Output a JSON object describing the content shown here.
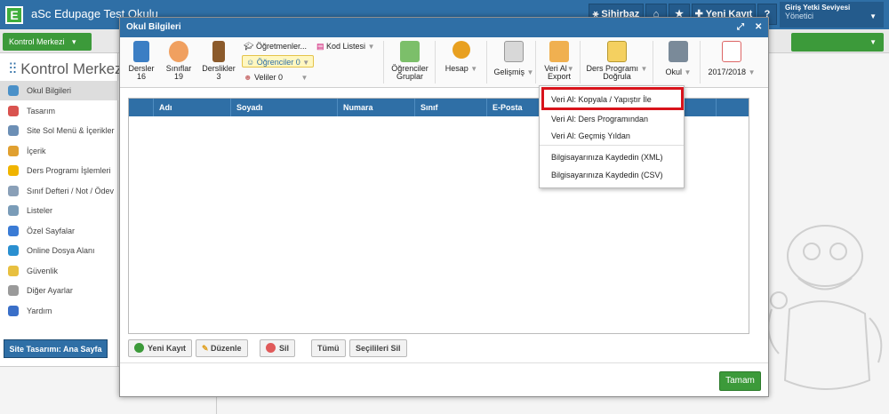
{
  "app": {
    "logo_letter": "E",
    "title": "aSc Edupage Test Okulu"
  },
  "topbar": {
    "sihirbaz": "Sihirbaz",
    "yeni_kayit": "Yeni Kayıt",
    "help": "?",
    "user_line1": "Giriş Yetki Seviyesi",
    "user_line2": "Yönetici"
  },
  "kontrol_button": "Kontrol Merkezi",
  "sidebar": {
    "title": "Kontrol Merkezi",
    "items": [
      {
        "label": "Okul Bilgileri",
        "color": "#4a90c8"
      },
      {
        "label": "Tasarım",
        "color": "#d9534f"
      },
      {
        "label": "Site Sol Menü & İçerikler",
        "color": "#6c8fb5"
      },
      {
        "label": "İçerik",
        "color": "#e0a030"
      },
      {
        "label": "Ders Programı İşlemleri",
        "color": "#f0b400"
      },
      {
        "label": "Sınıf Defteri / Not / Ödev",
        "color": "#8aa0b8"
      },
      {
        "label": "Listeler",
        "color": "#7a9cb8"
      },
      {
        "label": "Özel Sayfalar",
        "color": "#3a7bd5"
      },
      {
        "label": "Online Dosya Alanı",
        "color": "#2a8fd0"
      },
      {
        "label": "Güvenlik",
        "color": "#e8c040"
      },
      {
        "label": "Diğer Ayarlar",
        "color": "#9a9a9a"
      },
      {
        "label": "Yardım",
        "color": "#3a6fc8"
      }
    ],
    "site_button": "Site Tasarımı: Ana Sayfa"
  },
  "modal": {
    "title": "Okul Bilgileri",
    "toolbar": {
      "dersler": {
        "label": "Dersler",
        "count": "16"
      },
      "siniflar": {
        "label": "Sınıflar",
        "count": "19"
      },
      "derslikler": {
        "label": "Derslikler",
        "count": "3"
      },
      "ogretmenler": "Öğretmenler...",
      "ogrenciler": "Öğrenciler 0",
      "veliler": "Veliler 0",
      "kod_listesi": "Kod Listesi",
      "ogrenci_gruplar": {
        "line1": "Öğrenciler",
        "line2": "Gruplar"
      },
      "hesap": "Hesap",
      "gelismis": "Gelişmiş",
      "veri_al": {
        "line1": "Veri Al",
        "line2": "Export"
      },
      "ders_programi": {
        "line1": "Ders Programı",
        "line2": "Doğrula"
      },
      "okul": "Okul",
      "year": "2017/2018"
    },
    "grid_columns": [
      "Adı",
      "Soyadı",
      "Numara",
      "Sınıf",
      "E-Posta"
    ],
    "buttons": {
      "yeni_kayit": "Yeni Kayıt",
      "duzenle": "Düzenle",
      "sil": "Sil",
      "tumu": "Tümü",
      "secilileri_sil": "Seçilileri Sil",
      "tamam": "Tamam"
    }
  },
  "dropdown": {
    "items": [
      "Veri Al: Kopyala / Yapıştır İle",
      "Veri Al: Ders Programından",
      "Veri Al: Geçmiş Yıldan",
      "Bilgisayarınıza Kaydedin (XML)",
      "Bilgisayarınıza Kaydedin (CSV)"
    ]
  },
  "colors": {
    "primary": "#2f6fa6",
    "green": "#3c9a3a",
    "highlight": "#d8131b"
  }
}
